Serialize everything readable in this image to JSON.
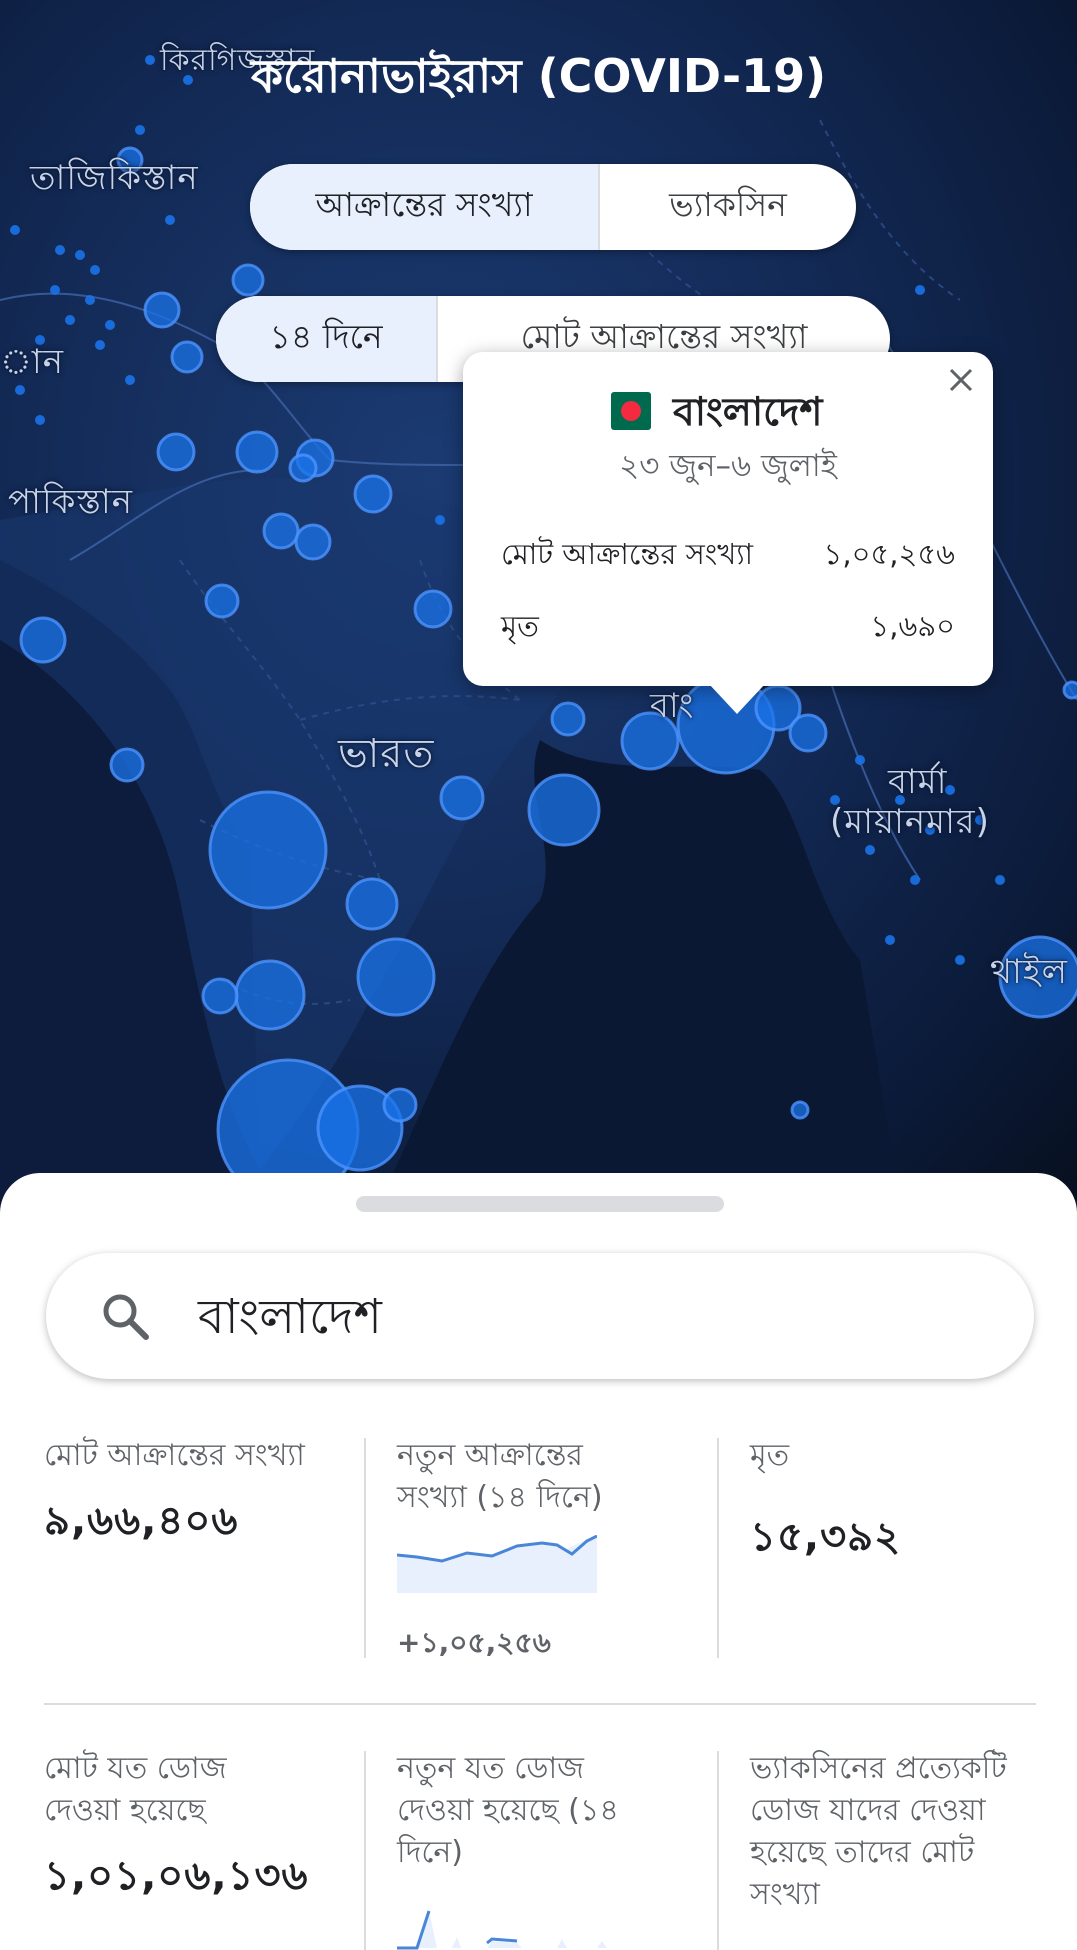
{
  "header": {
    "title": "করোনাভাইরাস (COVID-19)"
  },
  "metric_toggle": {
    "options": [
      "আক্রান্তের সংখ্যা",
      "ভ্যাকসিন"
    ],
    "selected": "আক্রান্তের সংখ্যা"
  },
  "period_toggle": {
    "options": [
      "১৪ দিনে",
      "মোট আক্রান্তের সংখ্যা"
    ],
    "selected": "১৪ দিনে"
  },
  "map": {
    "labels": {
      "kyrgyzstan": "কিরগিজস্তান",
      "tajikistan": "তাজিকিস্তান",
      "partial_left": "ান",
      "pakistan": "পাকিস্তান",
      "india": "ভারত",
      "burma": "বার্মা",
      "myanmar": "(মায়ানমার)",
      "thailand": "থাইল",
      "bangladesh_partial": "বাং"
    }
  },
  "tooltip": {
    "country": "বাংলাদেশ",
    "date_range": "২৩ জুন–৬ জুলাই",
    "rows": [
      {
        "label": "মোট আক্রান্তের সংখ্যা",
        "value": "১,০৫,২৫৬"
      },
      {
        "label": "মৃত",
        "value": "১,৬৯০"
      }
    ],
    "flag_colors": {
      "field": "#006a4e",
      "disc": "#f42a41"
    }
  },
  "search": {
    "value": "বাংলাদেশ"
  },
  "stats": {
    "total_cases": {
      "label": "মোট আক্রান্তের সংখ্যা",
      "value": "৯,৬৬,৪০৬"
    },
    "new_cases": {
      "label_line1": "নতুন আক্রান্তের",
      "label_line2": "সংখ্যা (১৪ দিনে)",
      "delta": "+১,০৫,২৫৬"
    },
    "deaths": {
      "label": "মৃত",
      "value": "১৫,৩৯২"
    },
    "total_doses": {
      "label_line1": "মোট যত ডোজ",
      "label_line2": "দেওয়া হয়েছে",
      "value": "১,০১,০৬,১৩৬"
    },
    "new_doses": {
      "label_line1": "নতুন যত ডোজ",
      "label_line2": "দেওয়া হয়েছে (১৪",
      "label_line3": "দিনে)"
    },
    "fully_vaccinated": {
      "label_line1": "ভ্যাকসিনের প্রত্যেকটি",
      "label_line2": "ডোজ যাদের দেওয়া",
      "label_line3": "হয়েছে তাদের মোট",
      "label_line4": "সংখ্যা"
    }
  },
  "colors": {
    "map_bg": "#132a56",
    "bubble": "#1a73e8",
    "accent_bg": "#e8f0fe",
    "sparkline": "#4a86d6"
  }
}
